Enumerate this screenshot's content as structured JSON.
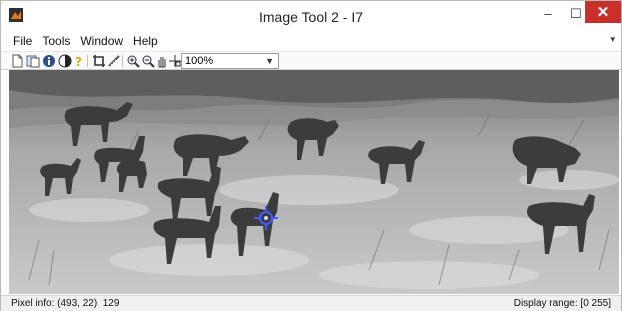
{
  "window": {
    "title": "Image Tool 2 - I7",
    "controls": {
      "minimize": "–",
      "maximize": "☐",
      "close": "✕"
    }
  },
  "menubar": {
    "items": [
      "File",
      "Tools",
      "Window",
      "Help"
    ]
  },
  "toolbar": {
    "buttons": [
      "new-figure-icon",
      "save-icon",
      "image-info-icon",
      "contrast-icon",
      "help-icon",
      "crop-icon",
      "measure-distance-icon",
      "zoom-in-icon",
      "zoom-out-icon",
      "pan-hand-icon",
      "pixel-region-icon"
    ],
    "zoom_value": "100%"
  },
  "image": {
    "description_icon": "deer-herd-grayscale-image",
    "cursor": "pixel-cursor-icon"
  },
  "statusbar": {
    "pixel_info": "Pixel info: (493, 22)  129",
    "display_range": "Display range: [0 255]"
  }
}
